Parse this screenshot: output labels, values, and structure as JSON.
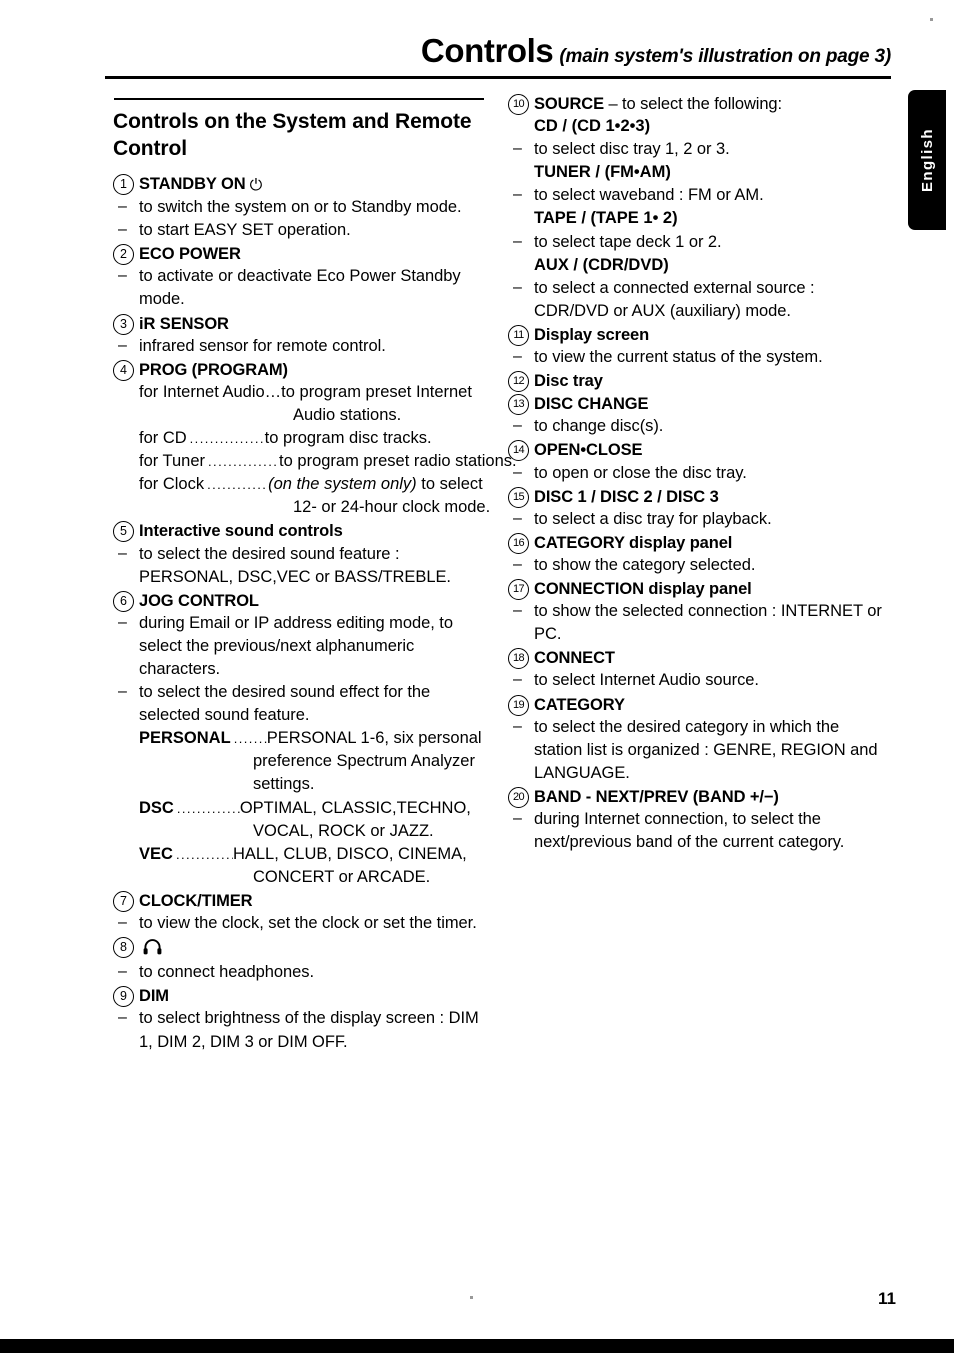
{
  "header": {
    "title": "Controls",
    "subtitle": "(main system's illustration on page 3)"
  },
  "lang_tab": {
    "label": "English"
  },
  "footer": {
    "page_number": "11"
  },
  "left_column": {
    "section_title": "Controls on the System and Remote Control",
    "entries": [
      {
        "num": "1",
        "term": "STANDBY ON",
        "icon": "power-icon",
        "lines": [
          {
            "type": "dash",
            "text": "to switch the system on or to Standby mode."
          },
          {
            "type": "dash",
            "text": "to start EASY SET operation."
          }
        ]
      },
      {
        "num": "2",
        "term": "ECO POWER",
        "lines": [
          {
            "type": "dash",
            "text": "to activate or deactivate Eco Power Standby mode."
          }
        ]
      },
      {
        "num": "3",
        "term": "iR SENSOR",
        "lines": [
          {
            "type": "dash",
            "text": "infrared sensor for remote control."
          }
        ]
      },
      {
        "num": "4",
        "term": "PROG (PROGRAM)",
        "lines": [
          {
            "type": "plain",
            "text": "for Internet Audio…to program preset Internet"
          },
          {
            "type": "cont-a",
            "text": "Audio stations."
          },
          {
            "type": "leader",
            "label": "for CD",
            "value": "to program disc tracks.",
            "dots_width": "w1"
          },
          {
            "type": "leader",
            "label": "for Tuner",
            "value": "to program preset radio stations.",
            "dots_width": "w2"
          },
          {
            "type": "leader",
            "label": "for Clock",
            "value_italic": "(on the system only)",
            "value": " to select",
            "dots_width": "w3"
          },
          {
            "type": "cont-a",
            "text": "12- or 24-hour clock mode."
          }
        ]
      },
      {
        "num": "5",
        "term": "Interactive sound controls",
        "lines": [
          {
            "type": "dash",
            "text": "to select the desired sound feature : PERSONAL, DSC,VEC or BASS/TREBLE."
          }
        ]
      },
      {
        "num": "6",
        "term": "JOG CONTROL",
        "lines": [
          {
            "type": "dash",
            "text": "during Email or IP address editing mode, to select the previous/next alphanumeric characters."
          },
          {
            "type": "dash",
            "text": "to select the desired sound effect for the selected sound feature."
          },
          {
            "type": "leader",
            "label": "PERSONAL",
            "bold_label": true,
            "value": "PERSONAL 1-6, six personal",
            "dots_width": "w4"
          },
          {
            "type": "cont",
            "text": "preference Spectrum Analyzer"
          },
          {
            "type": "cont",
            "text": "settings."
          },
          {
            "type": "leader",
            "label": "DSC",
            "bold_label": true,
            "value": "OPTIMAL, CLASSIC,TECHNO,",
            "dots_width": "w5"
          },
          {
            "type": "cont",
            "text": "VOCAL, ROCK or JAZZ."
          },
          {
            "type": "leader",
            "label": "VEC",
            "bold_label": true,
            "value": "HALL, CLUB, DISCO, CINEMA,",
            "dots_width": "w6"
          },
          {
            "type": "cont",
            "text": "CONCERT or ARCADE."
          }
        ]
      },
      {
        "num": "7",
        "term": "CLOCK/TIMER",
        "lines": [
          {
            "type": "dash",
            "text": "to view the clock, set the clock or set the timer."
          }
        ]
      },
      {
        "num": "8",
        "term": "",
        "icon": "headphones-icon",
        "lines": [
          {
            "type": "dash",
            "text": "to connect headphones."
          }
        ]
      },
      {
        "num": "9",
        "term": "DIM",
        "lines": [
          {
            "type": "dash",
            "text": "to select brightness of the display screen : DIM 1, DIM 2, DIM 3 or DIM OFF."
          }
        ]
      }
    ]
  },
  "right_column": {
    "entries": [
      {
        "num": "10",
        "term": "SOURCE",
        "term_suffix": " – to select the following:",
        "lines": [
          {
            "type": "sub",
            "text": "CD / (CD 1•2•3)"
          },
          {
            "type": "dash",
            "text": "to select disc tray 1, 2 or 3."
          },
          {
            "type": "sub",
            "text": "TUNER / (FM•AM)"
          },
          {
            "type": "dash",
            "text": "to select waveband : FM or AM."
          },
          {
            "type": "sub",
            "text": "TAPE / (TAPE 1• 2)"
          },
          {
            "type": "dash",
            "text": "to select tape deck 1 or 2."
          },
          {
            "type": "sub",
            "text": "AUX / (CDR/DVD)"
          },
          {
            "type": "dash",
            "text": "to select a connected external source : CDR/DVD or AUX (auxiliary) mode."
          }
        ]
      },
      {
        "num": "11",
        "term": "Display screen",
        "lines": [
          {
            "type": "dash",
            "text": "to view the current status of the system."
          }
        ]
      },
      {
        "num": "12",
        "term": "Disc tray",
        "lines": []
      },
      {
        "num": "13",
        "term": "DISC CHANGE",
        "lines": [
          {
            "type": "dash",
            "text": "to change disc(s)."
          }
        ]
      },
      {
        "num": "14",
        "term": "OPEN•CLOSE",
        "lines": [
          {
            "type": "dash",
            "text": "to open or close the disc tray."
          }
        ]
      },
      {
        "num": "15",
        "term": "DISC 1 / DISC 2 / DISC 3",
        "lines": [
          {
            "type": "dash",
            "text": "to select a disc tray for playback."
          }
        ]
      },
      {
        "num": "16",
        "term": "CATEGORY display panel",
        "lines": [
          {
            "type": "dash",
            "text": "to show the category selected."
          }
        ]
      },
      {
        "num": "17",
        "term": "CONNECTION display panel",
        "lines": [
          {
            "type": "dash",
            "text": "to show the selected connection : INTERNET or PC."
          }
        ]
      },
      {
        "num": "18",
        "term": "CONNECT",
        "lines": [
          {
            "type": "dash",
            "text": "to select Internet Audio source."
          }
        ]
      },
      {
        "num": "19",
        "term": "CATEGORY",
        "lines": [
          {
            "type": "dash",
            "text": "to select the desired category in which the station list is organized : GENRE, REGION and LANGUAGE."
          }
        ]
      },
      {
        "num": "20",
        "term": "BAND - NEXT/PREV (BAND +/−)",
        "lines": [
          {
            "type": "dash",
            "text": "during Internet connection, to select the next/previous band of the current category."
          }
        ]
      }
    ]
  }
}
